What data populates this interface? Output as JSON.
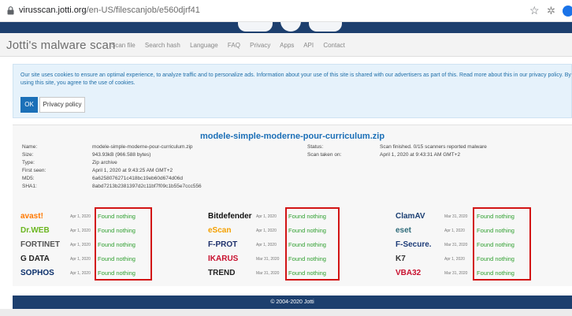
{
  "browser": {
    "url_host": "virusscan.jotti.org",
    "url_path": "/en-US/filescanjob/e560djrf41"
  },
  "site": {
    "brand": "Jotti's malware scan",
    "nav": [
      "Scan file",
      "Search hash",
      "Language",
      "FAQ",
      "Privacy",
      "Apps",
      "API",
      "Contact"
    ]
  },
  "cookie": {
    "text": "Our site uses cookies to ensure an optimal experience, to analyze traffic and to personalize ads. Information about your use of this site is shared with our advertisers as part of this. Read more about this in our privacy policy. By using this site, you agree to the use of cookies.",
    "ok": "OK",
    "privacy": "Privacy policy"
  },
  "file": {
    "title": "modele-simple-moderne-pour-curriculum.zip",
    "labels": {
      "name": "Name:",
      "size": "Size:",
      "type": "Type:",
      "first_seen": "First seen:",
      "md5": "MD5:",
      "sha1": "SHA1:",
      "status": "Status:",
      "scan_taken": "Scan taken on:"
    },
    "name": "modele-simple-moderne-pour-curriculum.zip",
    "size": "943.93kB (966.588 bytes)",
    "type": "Zip archive",
    "first_seen": "April 1, 2020 at 9:43:25 AM GMT+2",
    "md5": "6a6258076271c418bc19eb60d674d06d",
    "sha1": "8abd7213b2381397d2c11bf7f09c1b55e7ccc556",
    "status": "Scan finished. 0/15 scanners reported malware",
    "scan_taken": "April 1, 2020 at 9:43:31 AM GMT+2"
  },
  "results": {
    "col1": [
      {
        "engine": "avast!",
        "date": "Apr 1, 2020",
        "result": "Found nothing",
        "color": "#ff7800"
      },
      {
        "engine": "Dr.WEB",
        "date": "Apr 1, 2020",
        "result": "Found nothing",
        "color": "#6bb61f"
      },
      {
        "engine": "FORTINET",
        "date": "Apr 1, 2020",
        "result": "Found nothing",
        "color": "#555555"
      },
      {
        "engine": "G DATA",
        "date": "Apr 1, 2020",
        "result": "Found nothing",
        "color": "#222222"
      },
      {
        "engine": "SOPHOS",
        "date": "Apr 1, 2020",
        "result": "Found nothing",
        "color": "#0a2f6b"
      }
    ],
    "col2": [
      {
        "engine": "Bitdefender",
        "date": "Apr 1, 2020",
        "result": "Found nothing",
        "color": "#111111"
      },
      {
        "engine": "eScan",
        "date": "Apr 1, 2020",
        "result": "Found nothing",
        "color": "#f4a000"
      },
      {
        "engine": "F-PROT",
        "date": "Apr 1, 2020",
        "result": "Found nothing",
        "color": "#1d2f6b"
      },
      {
        "engine": "IKARUS",
        "date": "Mar 31, 2020",
        "result": "Found nothing",
        "color": "#c8102e"
      },
      {
        "engine": "TREND",
        "date": "Mar 31, 2020",
        "result": "Found nothing",
        "color": "#222222"
      }
    ],
    "col3": [
      {
        "engine": "ClamAV",
        "date": "Mar 31, 2020",
        "result": "Found nothing",
        "color": "#1c3f73"
      },
      {
        "engine": "eset",
        "date": "Apr 1, 2020",
        "result": "Found nothing",
        "color": "#2e6b7a"
      },
      {
        "engine": "F-Secure.",
        "date": "Mar 31, 2020",
        "result": "Found nothing",
        "color": "#1d3c78"
      },
      {
        "engine": "K7",
        "date": "Apr 1, 2020",
        "result": "Found nothing",
        "color": "#333333"
      },
      {
        "engine": "VBA32",
        "date": "Mar 31, 2020",
        "result": "Found nothing",
        "color": "#c8102e"
      }
    ]
  },
  "footer": "© 2004-2020 Jotti"
}
